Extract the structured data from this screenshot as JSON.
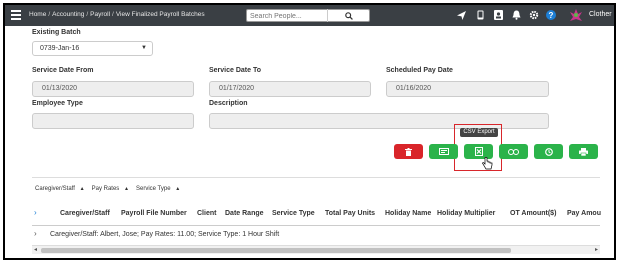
{
  "breadcrumb": [
    "Home",
    "Accounting",
    "Payroll",
    "View Finalized Payroll Batches"
  ],
  "breadcrumb_separator": "/",
  "search": {
    "placeholder": "Search People..."
  },
  "user": {
    "name": "Clother"
  },
  "form": {
    "existing_batch": {
      "label": "Existing Batch",
      "value": "0739-Jan-16"
    },
    "service_date_from": {
      "label": "Service Date From",
      "value": "01/13/2020"
    },
    "service_date_to": {
      "label": "Service Date To",
      "value": "01/17/2020"
    },
    "scheduled_pay_date": {
      "label": "Scheduled Pay Date",
      "value": "01/16/2020"
    },
    "employee_type": {
      "label": "Employee Type",
      "value": ""
    },
    "description": {
      "label": "Description",
      "value": ""
    }
  },
  "actions": {
    "tooltip": "CSV Export",
    "buttons": [
      {
        "name": "delete",
        "icon": "trash-icon",
        "color": "#d9252a"
      },
      {
        "name": "export-a",
        "icon": "card-icon",
        "color": "#2bb34a"
      },
      {
        "name": "csv-export",
        "icon": "excel-icon",
        "color": "#2bb34a"
      },
      {
        "name": "quickbooks",
        "icon": "qb-icon",
        "color": "#2bb34a"
      },
      {
        "name": "clock",
        "icon": "clock-icon",
        "color": "#2bb34a"
      },
      {
        "name": "print",
        "icon": "print-icon",
        "color": "#2bb34a"
      }
    ]
  },
  "grid": {
    "group_chips": [
      "Caregiver/Staff",
      "Pay Rates",
      "Service Type"
    ],
    "columns": [
      "Caregiver/Staff",
      "Payroll File Number",
      "Client",
      "Date Range",
      "Service Type",
      "Total Pay Units",
      "Holiday Name",
      "Holiday Multiplier",
      "OT Amount($)",
      "Pay Amou"
    ],
    "group_row": "Caregiver/Staff: Albert, Jose; Pay Rates: 11.00; Service Type: 1 Hour Shift"
  }
}
